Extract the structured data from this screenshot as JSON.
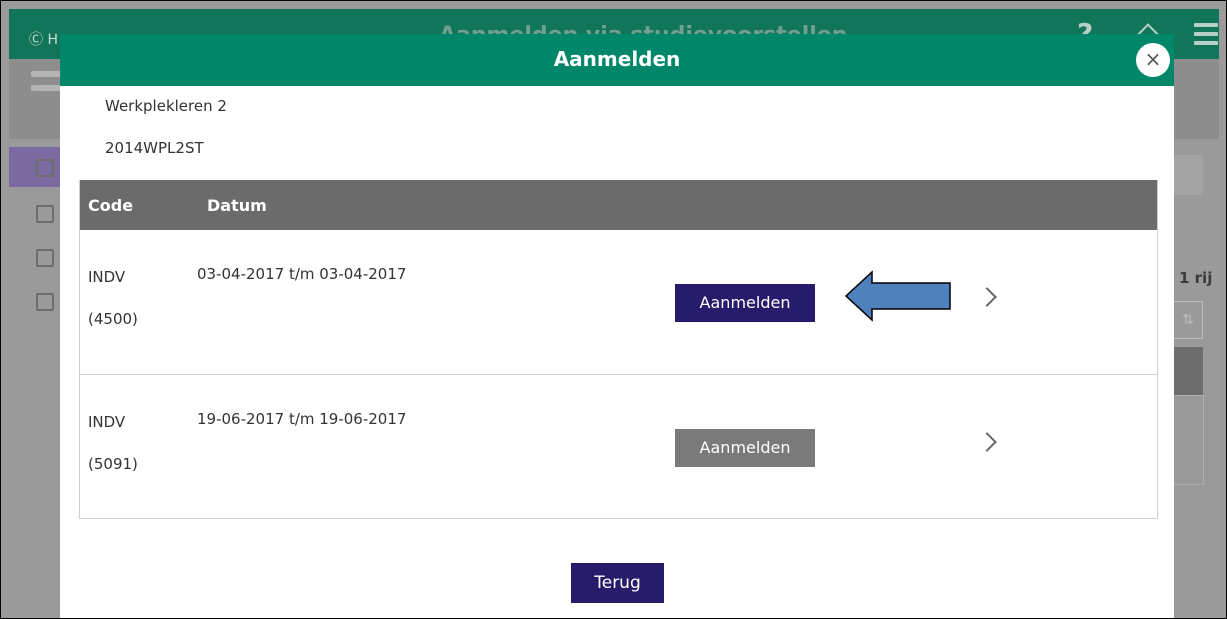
{
  "background": {
    "home_label": "Ⓒ H",
    "title": "Aanmelden via studievoorstellen",
    "help_symbol": "?",
    "right_partial_text": "1 rij",
    "sort_symbol": "⇅"
  },
  "modal": {
    "title": "Aanmelden",
    "close_symbol": "×",
    "course_name": "Werkplekleren 2",
    "course_code": "2014WPL2ST",
    "table": {
      "headers": [
        "Code",
        "Datum"
      ],
      "rows": [
        {
          "code": "INDV",
          "number": "(4500)",
          "date": "03-04-2017 t/m 03-04-2017",
          "button": "Aanmelden",
          "enabled": true
        },
        {
          "code": "INDV",
          "number": "(5091)",
          "date": "19-06-2017 t/m 19-06-2017",
          "button": "Aanmelden",
          "enabled": false
        }
      ]
    },
    "back_label": "Terug"
  },
  "colors": {
    "header_green": "#00876a",
    "button_purple": "#261c6b",
    "button_disabled": "#7a7a7a",
    "table_header": "#6b6b6b",
    "arrow_blue": "#4f81bd"
  }
}
